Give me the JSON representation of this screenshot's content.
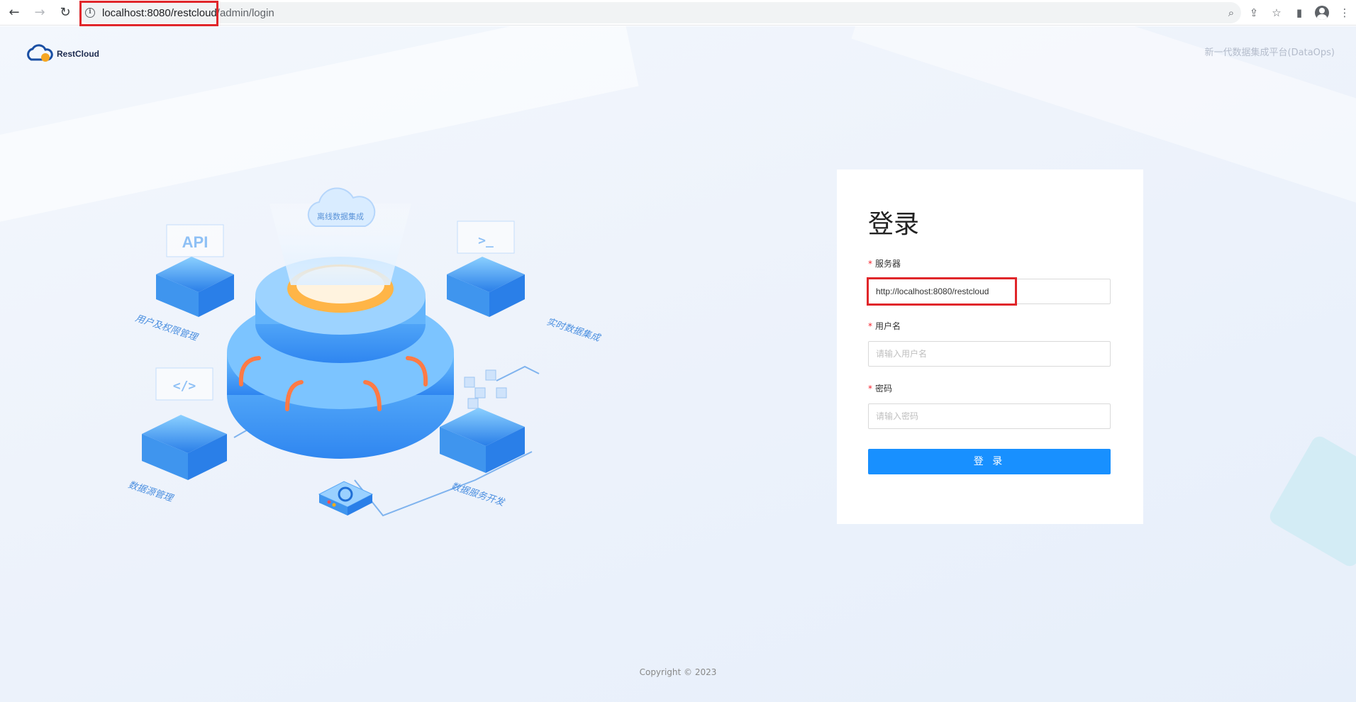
{
  "browser": {
    "url_host": "localhost:8080/restcloud",
    "url_path": "/admin/login",
    "back_icon": "←",
    "forward_icon": "→",
    "reload_icon": "↻",
    "info_icon": "i",
    "zoom_icon": "⌕",
    "share_icon": "⇪",
    "star_icon": "☆",
    "sidepanel_icon": "▮",
    "menu_icon": "⋮"
  },
  "header": {
    "logo_text": "RestCloud",
    "slogan": "新一代数据集成平台(DataOps)"
  },
  "illustration": {
    "center_label": "离线数据集成",
    "node_labels": [
      "用户及权限管理",
      "实时数据集成",
      "数据源管理",
      "数据服务开发"
    ],
    "api_text": "API",
    "code_text": "</>",
    "cli_text": ">_"
  },
  "login": {
    "title": "登录",
    "server_label": "服务器",
    "server_value": "http://localhost:8080/restcloud",
    "username_label": "用户名",
    "username_placeholder": "请输入用户名",
    "password_label": "密码",
    "password_placeholder": "请输入密码",
    "submit_label": "登 录",
    "required_mark": "*"
  },
  "footer": {
    "copyright": "Copyright © 2023"
  }
}
